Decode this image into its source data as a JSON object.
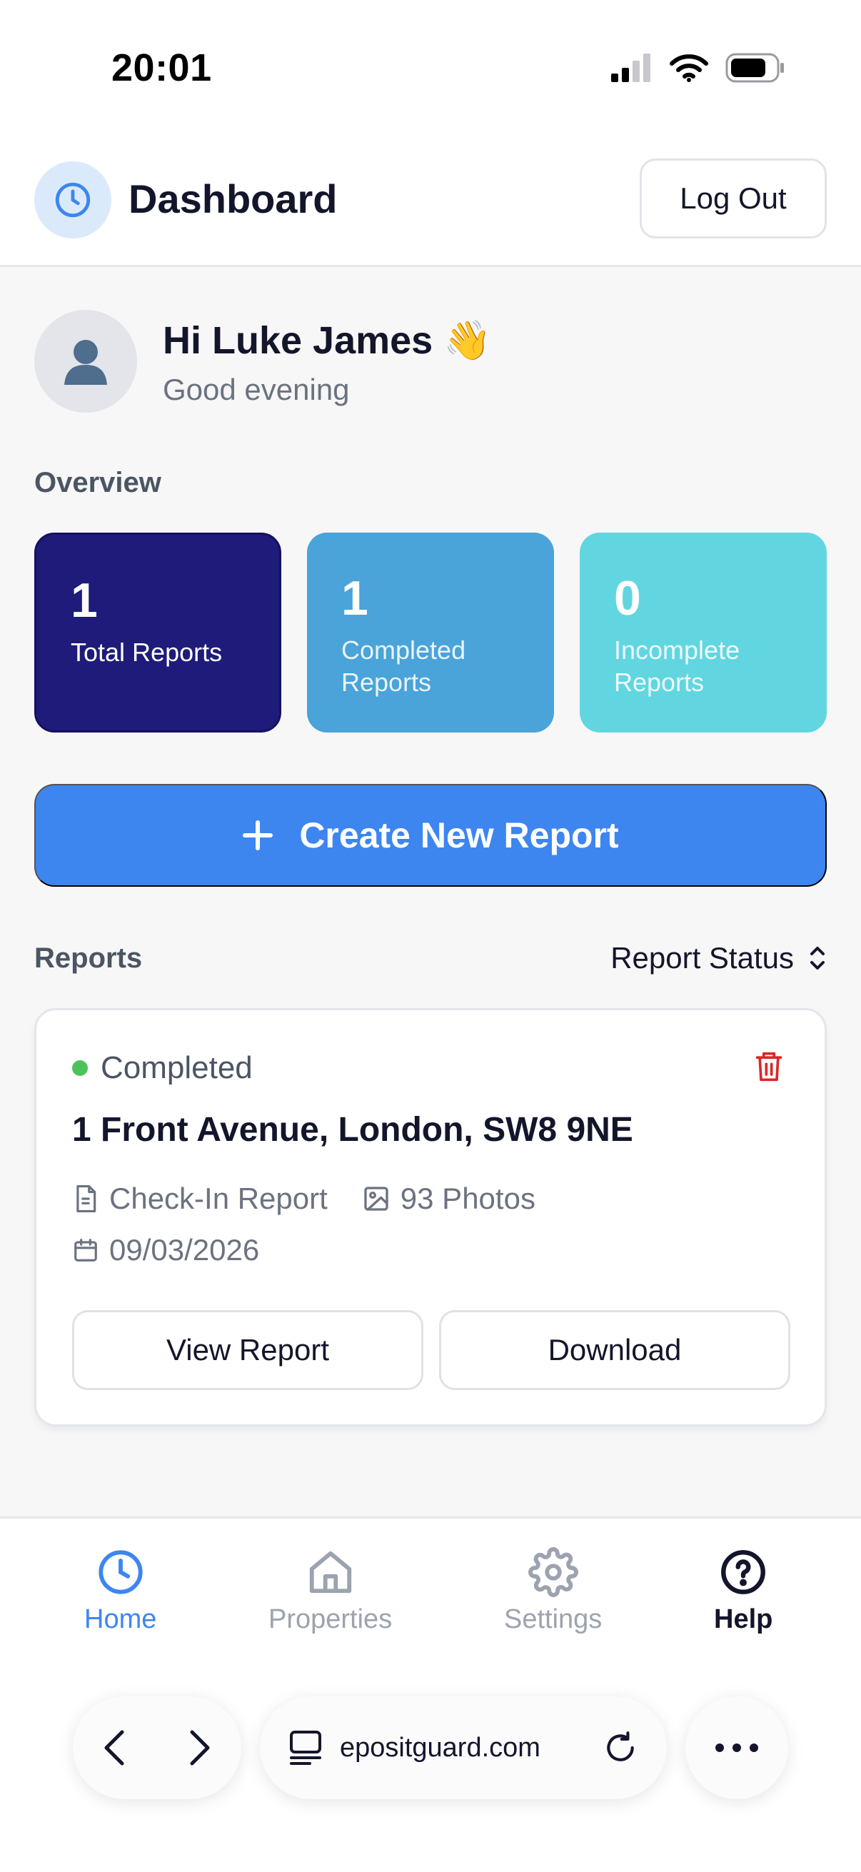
{
  "status_bar": {
    "time": "20:01",
    "icons": [
      "cellular-signal-icon",
      "wifi-icon",
      "battery-icon"
    ]
  },
  "header": {
    "logo_icon": "clock-icon",
    "title": "Dashboard",
    "logout_label": "Log Out"
  },
  "greeting": {
    "avatar_icon": "user-icon",
    "name": "Hi Luke James",
    "emoji": "👋",
    "subtitle": "Good evening"
  },
  "overview": {
    "label": "Overview",
    "stats": [
      {
        "value": "1",
        "label": "Total Reports",
        "color": "#1e1b7b"
      },
      {
        "value": "1",
        "label": "Completed Reports",
        "color": "#4aa3d9"
      },
      {
        "value": "0",
        "label": "Incomplete Reports",
        "color": "#62d6e0"
      }
    ]
  },
  "create_button": {
    "icon": "plus-icon",
    "label": "Create New Report",
    "color": "#3d86f0"
  },
  "reports": {
    "label": "Reports",
    "sort_label": "Report Status",
    "items": [
      {
        "status": "Completed",
        "status_color": "#4cc35a",
        "address": "1 Front Avenue, London, SW8 9NE",
        "type": "Check-In Report",
        "photos": "93 Photos",
        "date": "09/03/2026",
        "view_label": "View Report",
        "download_label": "Download",
        "delete_icon": "trash-icon"
      }
    ]
  },
  "bottom_nav": {
    "items": [
      {
        "label": "Home",
        "icon": "clock-icon",
        "active": true
      },
      {
        "label": "Properties",
        "icon": "home-icon",
        "active": false
      },
      {
        "label": "Settings",
        "icon": "gear-icon",
        "active": false
      },
      {
        "label": "Help",
        "icon": "help-circle-icon",
        "active": false
      }
    ],
    "active_color": "#3d86f0"
  },
  "browser": {
    "url": "epositguard.com",
    "icons": [
      "back-icon",
      "forward-icon",
      "tabs-icon",
      "reload-icon",
      "more-icon"
    ]
  }
}
